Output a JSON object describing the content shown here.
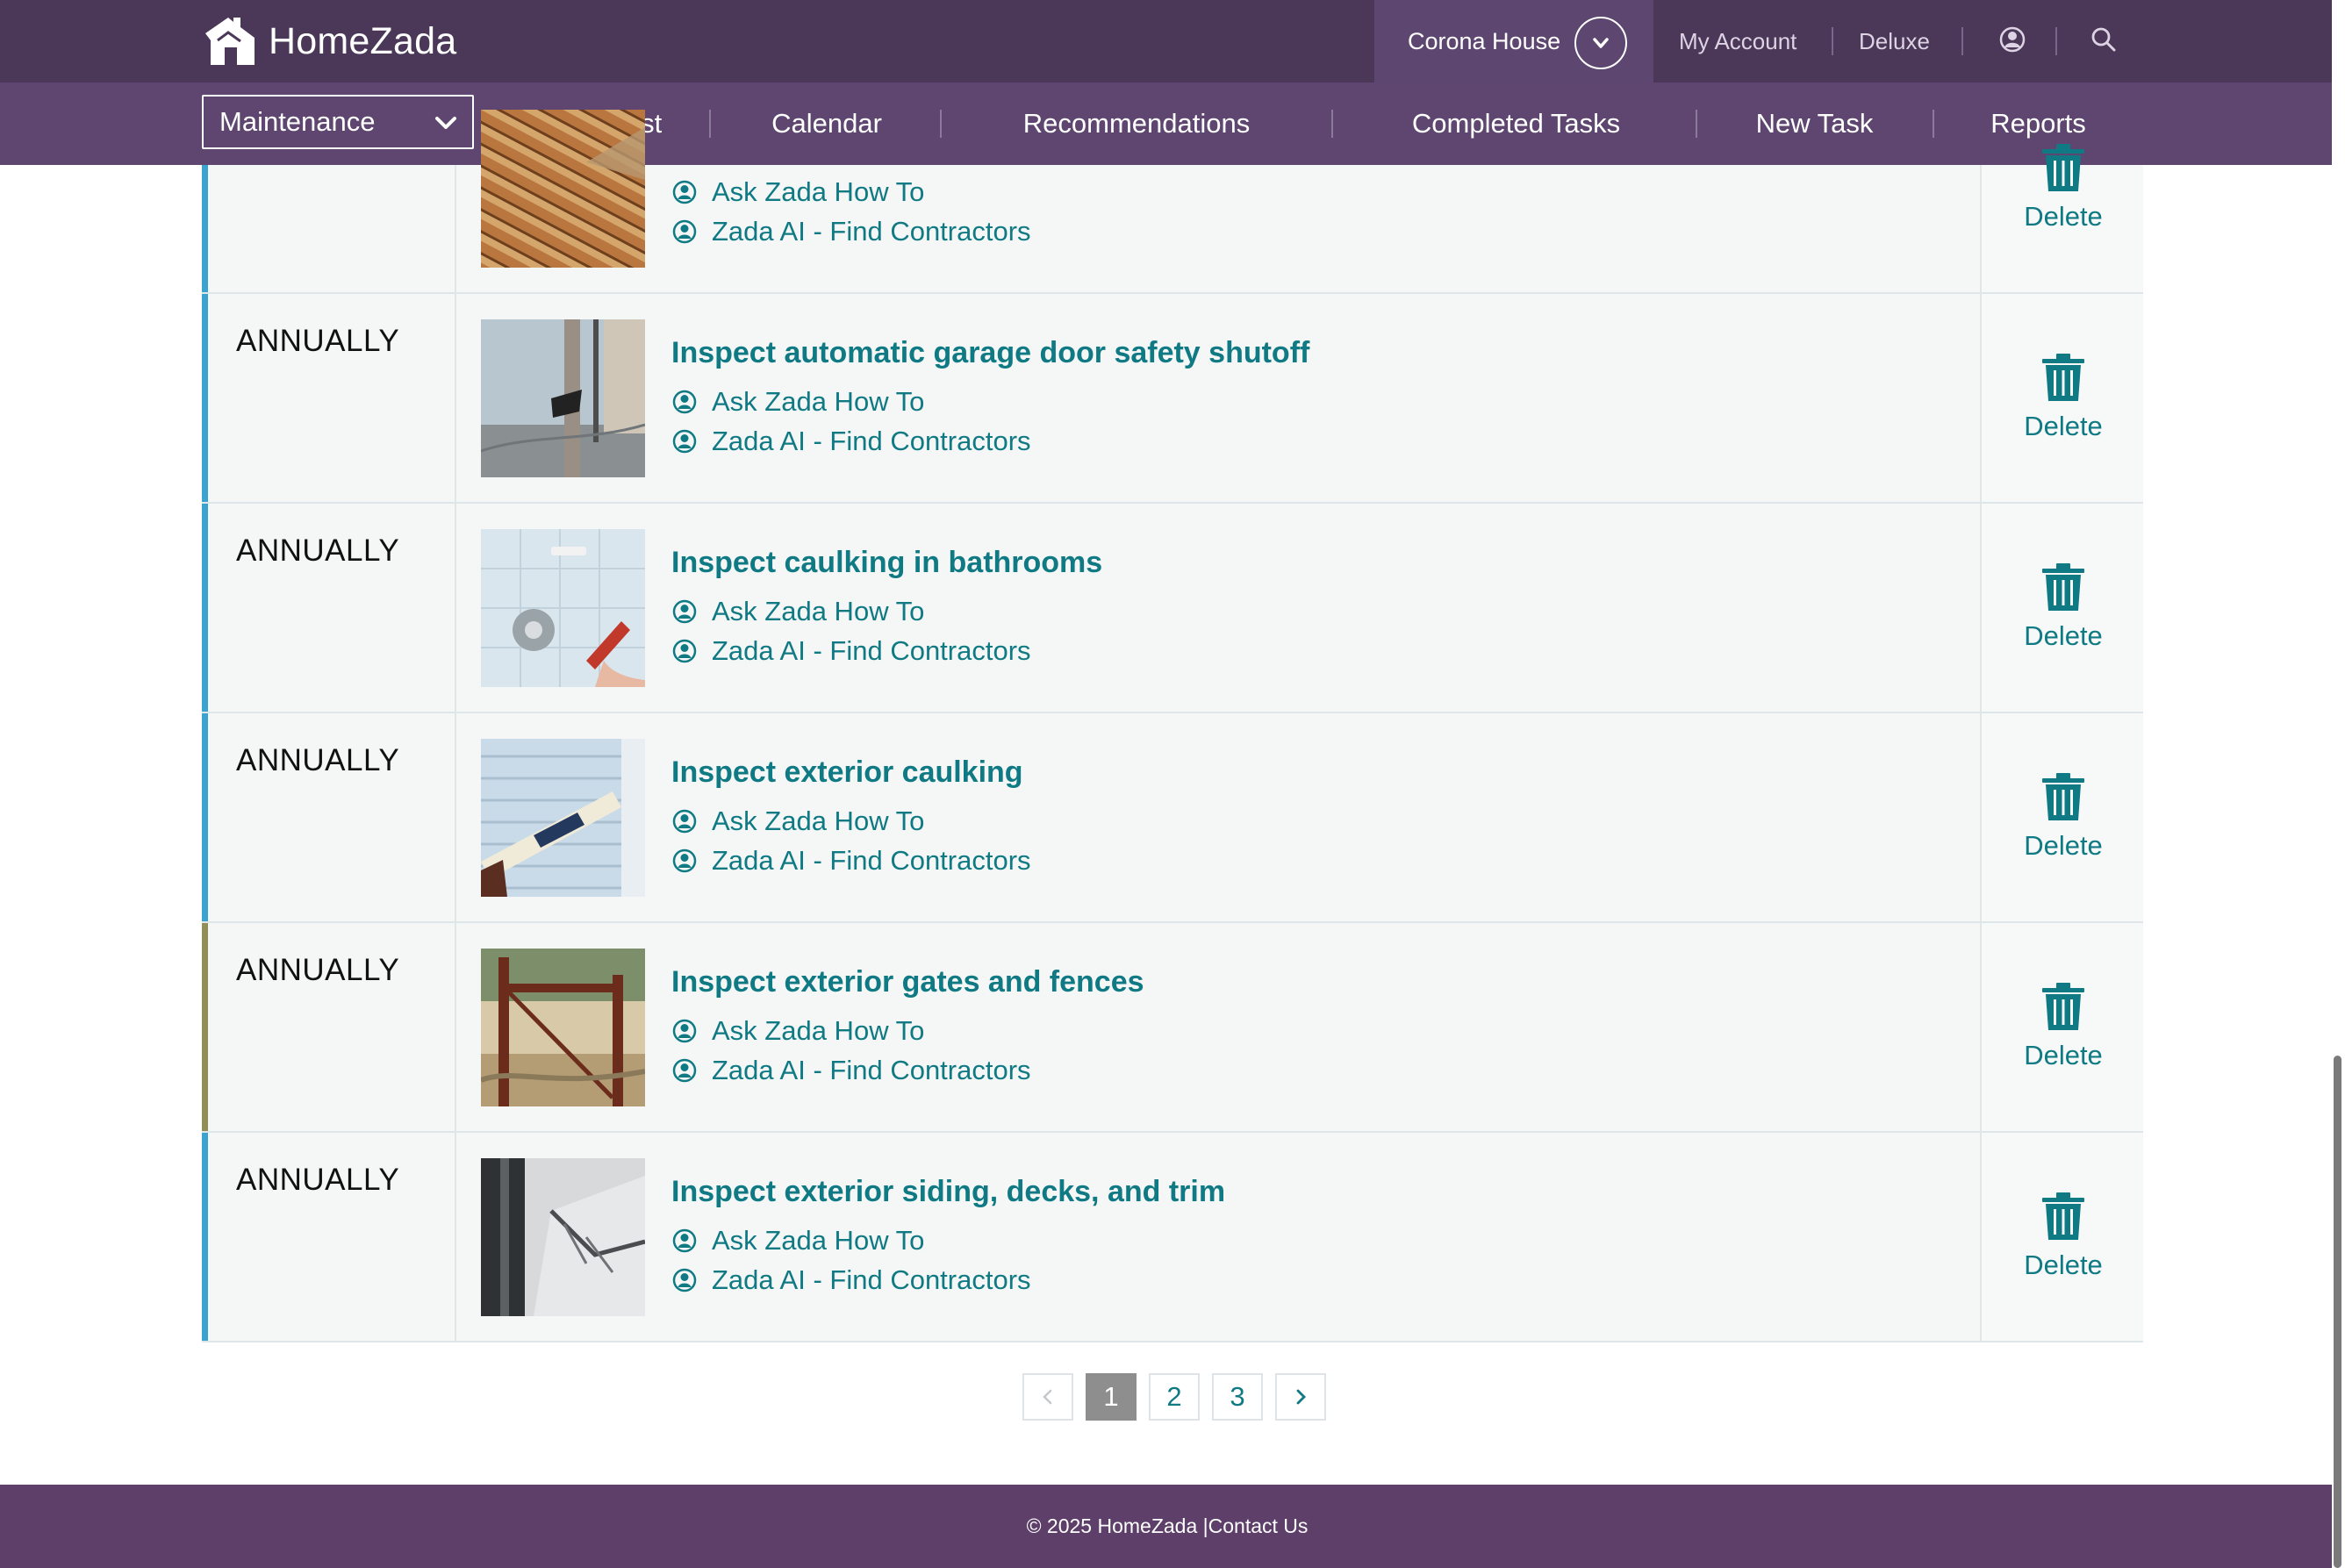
{
  "app": {
    "brand": "HomeZada",
    "house_name": "Corona House",
    "account_label": "My Account",
    "plan_label": "Deluxe",
    "icons": {
      "logo": "house-logo-icon",
      "toggle": "chevron-down-icon",
      "user": "user-icon",
      "search": "search-icon"
    }
  },
  "subnav": {
    "module": "Maintenance",
    "items": [
      "Task List",
      "Calendar",
      "Recommendations",
      "Completed Tasks",
      "New Task",
      "Reports"
    ]
  },
  "tasks": [
    {
      "frequency": "",
      "title": "",
      "link_howto": "Ask Zada How To",
      "link_contractors": "Zada AI - Find Contractors",
      "delete_label": "Delete",
      "accent": "#3aa3cf"
    },
    {
      "frequency": "ANNUALLY",
      "title": "Inspect automatic garage door safety shutoff",
      "link_howto": "Ask Zada How To",
      "link_contractors": "Zada AI - Find Contractors",
      "delete_label": "Delete",
      "accent": "#3aa3cf"
    },
    {
      "frequency": "ANNUALLY",
      "title": "Inspect caulking in bathrooms",
      "link_howto": "Ask Zada How To",
      "link_contractors": "Zada AI - Find Contractors",
      "delete_label": "Delete",
      "accent": "#3aa3cf"
    },
    {
      "frequency": "ANNUALLY",
      "title": "Inspect exterior caulking",
      "link_howto": "Ask Zada How To",
      "link_contractors": "Zada AI - Find Contractors",
      "delete_label": "Delete",
      "accent": "#3aa3cf"
    },
    {
      "frequency": "ANNUALLY",
      "title": "Inspect exterior gates and fences",
      "link_howto": "Ask Zada How To",
      "link_contractors": "Zada AI - Find Contractors",
      "delete_label": "Delete",
      "accent": "#8f8f57"
    },
    {
      "frequency": "ANNUALLY",
      "title": "Inspect exterior siding, decks, and trim",
      "link_howto": "Ask Zada How To",
      "link_contractors": "Zada AI - Find Contractors",
      "delete_label": "Delete",
      "accent": "#3aa3cf"
    }
  ],
  "pagination": {
    "pages": [
      "1",
      "2",
      "3"
    ],
    "current": "1"
  },
  "footer": {
    "copyright": "© 2025 HomeZada | ",
    "contact": "Contact Us"
  },
  "colors": {
    "header": "#4b3858",
    "subnav": "#5e4670",
    "link": "#0f7a84",
    "footer": "#5d3f69"
  }
}
